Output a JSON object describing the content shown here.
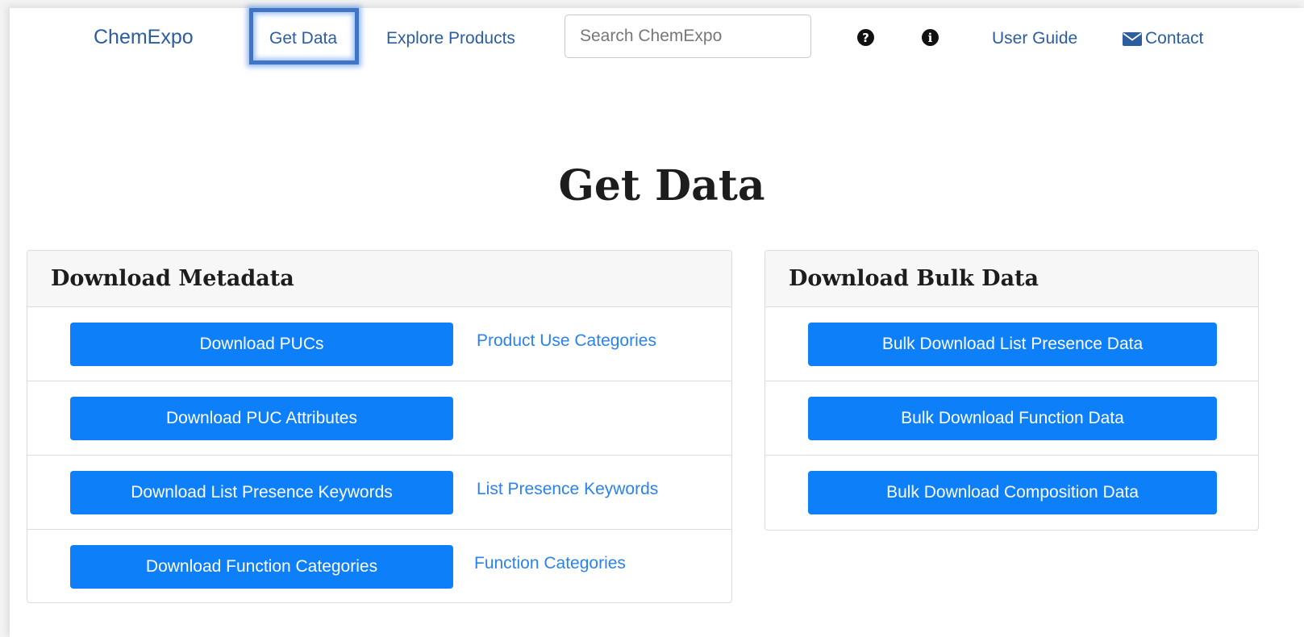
{
  "nav": {
    "brand": "ChemExpo",
    "get_data": "Get Data",
    "explore_products": "Explore Products",
    "search_placeholder": "Search ChemExpo",
    "help_icon": "?",
    "info_icon": "i",
    "user_guide": "User Guide",
    "contact": "Contact"
  },
  "page_title": "Get Data",
  "metadata": {
    "header": "Download Metadata",
    "rows": [
      {
        "button": "Download PUCs",
        "link": "Product Use Categories"
      },
      {
        "button": "Download PUC Attributes",
        "link": ""
      },
      {
        "button": "Download List Presence Keywords",
        "link": "List Presence Keywords"
      },
      {
        "button": "Download Function Categories",
        "link": "Function Categories"
      }
    ]
  },
  "bulk": {
    "header": "Download Bulk Data",
    "rows": [
      {
        "button": "Bulk Download List Presence Data"
      },
      {
        "button": "Bulk Download Function Data"
      },
      {
        "button": "Bulk Download Composition Data"
      }
    ]
  },
  "colors": {
    "nav_link": "#2c5d9f",
    "button": "#0d7ff9",
    "link": "#2a82f0",
    "highlight": "#3f74c6"
  }
}
